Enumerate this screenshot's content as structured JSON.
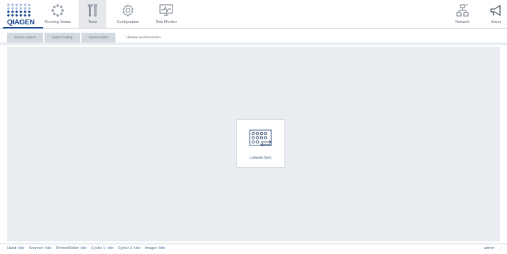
{
  "logo": {
    "text": "QIAGEN"
  },
  "nav": {
    "running_status": "Running Status",
    "tools": "Tools",
    "configuration": "Configuration",
    "disk_monitor": "Disk Monitor",
    "network": "Network",
    "alarm": "Alarm"
  },
  "tabs": [
    {
      "label": "System support"
    },
    {
      "label": "System testing"
    },
    {
      "label": "System status"
    },
    {
      "label": "Labware synchronization"
    }
  ],
  "main": {
    "card_label": "Labware Sync"
  },
  "status": {
    "items": [
      {
        "label": "Hand:",
        "value": "Idle"
      },
      {
        "label": "Scanner:",
        "value": "Idle"
      },
      {
        "label": "Printer/Roller:",
        "value": "Idle"
      },
      {
        "label": "Cycler 1:",
        "value": "Idle"
      },
      {
        "label": "Cycler 2:",
        "value": "Idle"
      },
      {
        "label": "Imager:",
        "value": "Idle"
      }
    ],
    "user": "admin",
    "arrow": "→"
  },
  "colors": {
    "brand": "#1c4a93",
    "logo_dots_light": "#9fb9dd",
    "active_nav_bg": "#e6e8ec",
    "workspace_bg": "#e9edf2",
    "idle_value": "#4c73a8"
  }
}
